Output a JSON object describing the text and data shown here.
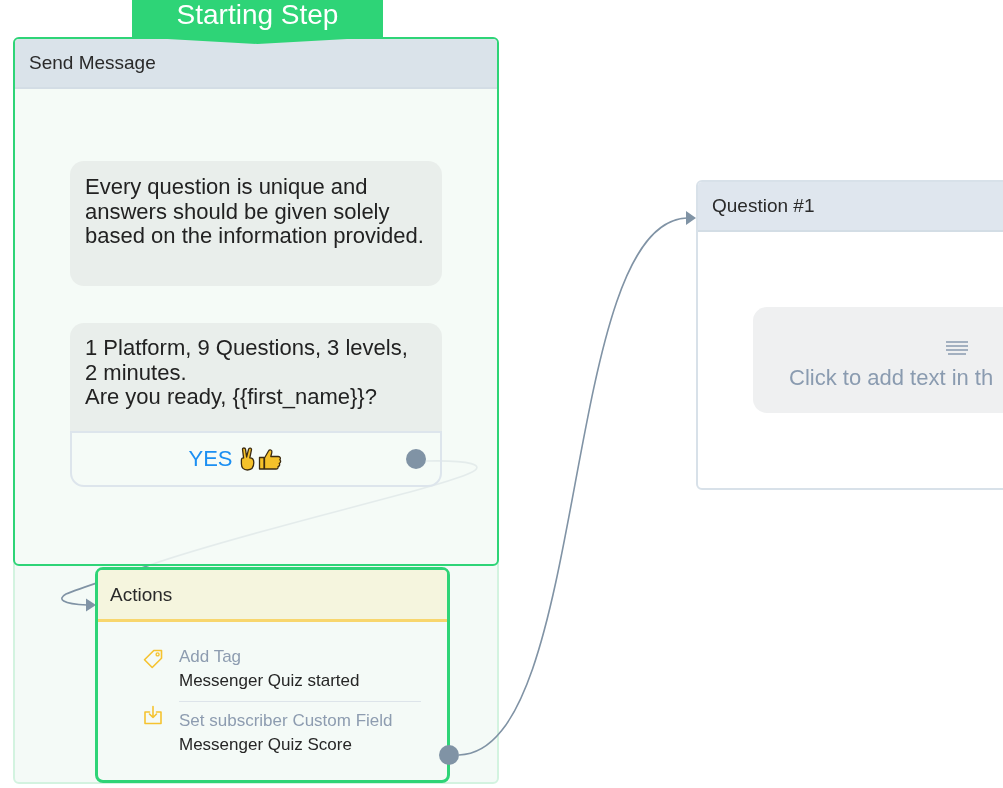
{
  "canvas": {
    "nodes": [
      {
        "kind": "message",
        "title": "Send Message",
        "highlighted": true,
        "badge": "Starting Step",
        "messages": [
          {
            "kind": "text",
            "text": "Every question is unique and\nanswers should be given solely\nbased on the information provided."
          },
          {
            "kind": "text",
            "text": "1 Platform, 9 Questions, 3 levels,\n2 minutes.\nAre you ready, {{first_name}}?",
            "buttons": [
              {
                "label": "YES"
              }
            ]
          }
        ]
      },
      {
        "kind": "actions",
        "title": "Actions",
        "highlighted": true,
        "actions": [
          {
            "kind": "tag",
            "label": "Add Tag",
            "value": "Messenger Quiz started"
          },
          {
            "kind": "custom_field",
            "label": "Set subscriber Custom Field",
            "value": "Messenger Quiz Score"
          }
        ]
      },
      {
        "kind": "message",
        "title": "Question #1",
        "highlighted": false,
        "messages": [
          {
            "kind": "empty",
            "prompt": "Click to add text in th"
          }
        ]
      }
    ]
  }
}
